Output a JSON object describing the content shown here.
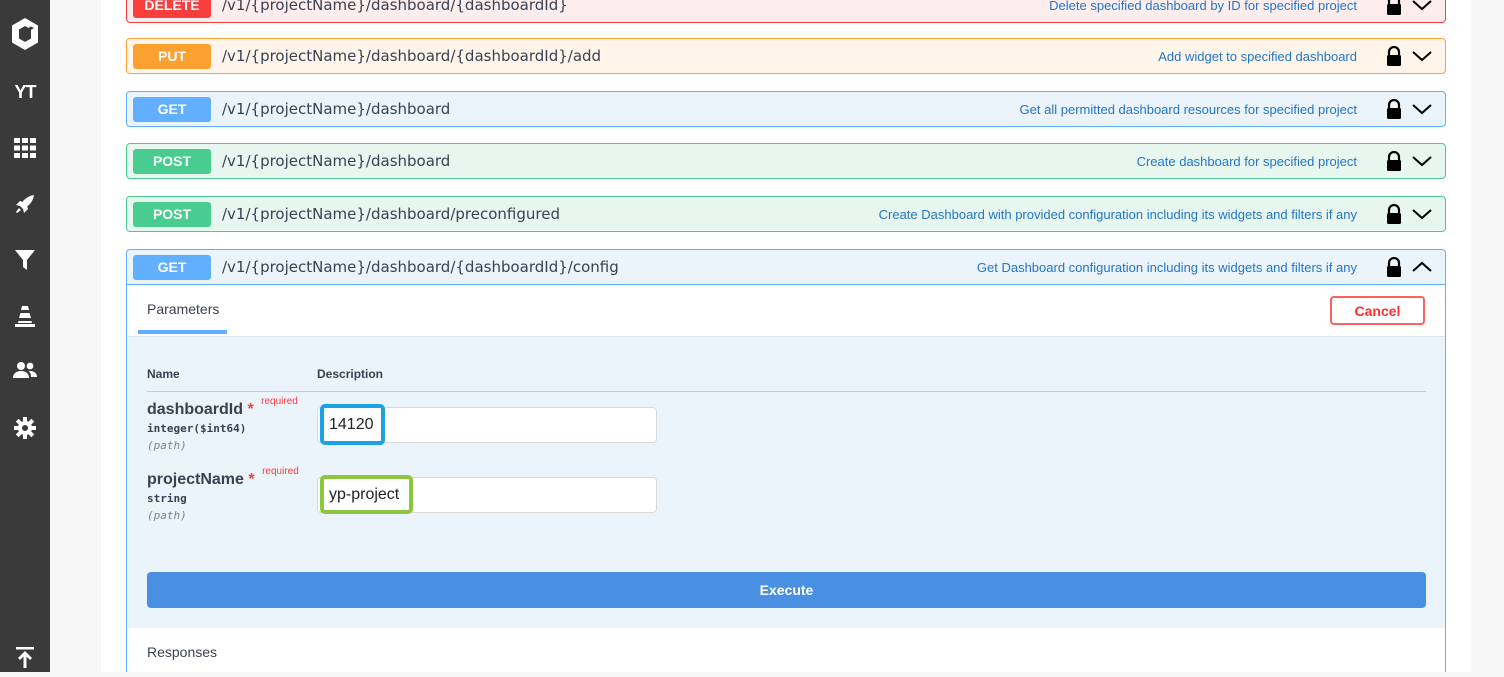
{
  "sidebar": {
    "items": [
      {
        "icon": "logo-icon"
      },
      {
        "icon": "yt-text-icon",
        "text": "YT"
      },
      {
        "icon": "grid-icon"
      },
      {
        "icon": "rocket-icon"
      },
      {
        "icon": "filter-icon"
      },
      {
        "icon": "cone-icon"
      },
      {
        "icon": "people-icon"
      },
      {
        "icon": "gear-icon"
      },
      {
        "icon": "scroll-top-icon"
      }
    ]
  },
  "operations": [
    {
      "method": "DELETE",
      "path": "/v1/{projectName}/dashboard/{dashboardId}",
      "summary": "Delete specified dashboard by ID for specified project"
    },
    {
      "method": "PUT",
      "path": "/v1/{projectName}/dashboard/{dashboardId}/add",
      "summary": "Add widget to specified dashboard"
    },
    {
      "method": "GET",
      "path": "/v1/{projectName}/dashboard",
      "summary": "Get all permitted dashboard resources for specified project"
    },
    {
      "method": "POST",
      "path": "/v1/{projectName}/dashboard",
      "summary": "Create dashboard for specified project"
    },
    {
      "method": "POST",
      "path": "/v1/{projectName}/dashboard/preconfigured",
      "summary": "Create Dashboard with provided configuration including its widgets and filters if any"
    },
    {
      "method": "GET",
      "path": "/v1/{projectName}/dashboard/{dashboardId}/config",
      "summary": "Get Dashboard configuration including its widgets and filters if any"
    }
  ],
  "panel": {
    "tab_label": "Parameters",
    "cancel_label": "Cancel",
    "col_name": "Name",
    "col_description": "Description",
    "params": [
      {
        "name": "dashboardId",
        "star": "*",
        "required": "required",
        "type": "integer($int64)",
        "in": "(path)",
        "value": "14120"
      },
      {
        "name": "projectName",
        "star": "*",
        "required": "required",
        "type": "string",
        "in": "(path)",
        "value": "yp-project"
      }
    ],
    "execute_label": "Execute",
    "responses_label": "Responses"
  },
  "colors": {
    "delete": "#f93e3e",
    "put": "#fca130",
    "get": "#61affe",
    "post": "#49cc90",
    "execute": "#4990e2",
    "highlight_blue": "#1aa1e6",
    "highlight_green": "#8cc63f"
  }
}
